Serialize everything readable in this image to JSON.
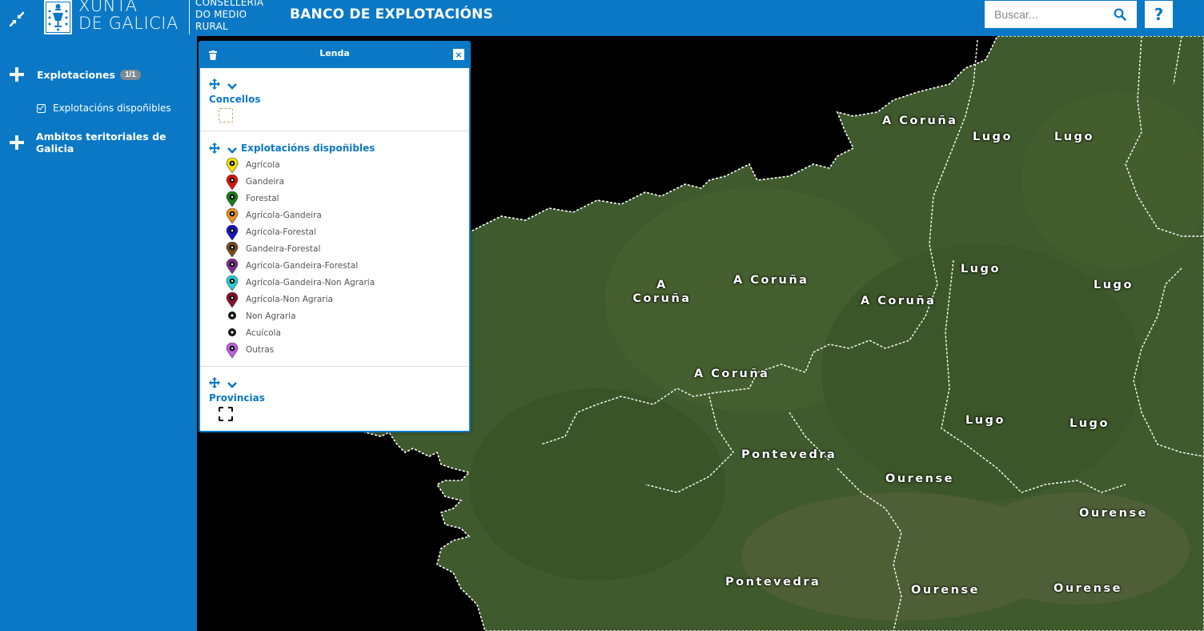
{
  "header": {
    "logo_line1": "XUNTA",
    "logo_line2": "DE GALICIA",
    "consel_line1": "CONSELLERÍA",
    "consel_line2": "DO MEDIO",
    "consel_line3": "RURAL",
    "title": "BANCO DE EXPLOTACIÓNS",
    "search_placeholder": "Buscar...",
    "help_label": "?"
  },
  "sidebar": {
    "groups": [
      {
        "label": "Explotaciones",
        "badge": "1/1"
      },
      {
        "label": "Ambitos teritoriales de Galicia"
      }
    ],
    "sublayer": "Explotacións dispoñibles"
  },
  "legend": {
    "title": "Lenda",
    "close_label": "×",
    "sections": [
      {
        "title": "Concellos",
        "swatch_color": "#c8a063"
      },
      {
        "title": "Explotacións dispoñibles"
      },
      {
        "title": "Provincias",
        "swatch_color": "#000000"
      }
    ],
    "items": [
      {
        "label": "Agrícola",
        "color": "#f5e400"
      },
      {
        "label": "Gandeira",
        "color": "#e3120b"
      },
      {
        "label": "Forestal",
        "color": "#1a7d1a"
      },
      {
        "label": "Agrícola-Gandeira",
        "color": "#f09020"
      },
      {
        "label": "Agrícola-Forestal",
        "color": "#1414c8"
      },
      {
        "label": "Gandeira-Forestal",
        "color": "#7a4a1e"
      },
      {
        "label": "Agrícola-Gandeira-Forestal",
        "color": "#7a2f8f"
      },
      {
        "label": "Agrícola-Gandeira-Non Agraria",
        "color": "#20d0d8"
      },
      {
        "label": "Agrícola-Non Agraria",
        "color": "#8a1030"
      },
      {
        "label": "Non Agraria",
        "color": "#111111"
      },
      {
        "label": "Acuícola",
        "color": "#111111"
      },
      {
        "label": "Outras",
        "color": "#c060e0"
      }
    ]
  },
  "map": {
    "labels": [
      "A Coruña",
      "Lugo",
      "Lugo",
      "A Coruña",
      "A Coruña",
      "A Coruña",
      "Lugo",
      "Lugo",
      "A Coruña",
      "Lugo",
      "Lugo",
      "Pontevedra",
      "Ourense",
      "Ourense",
      "Pontevedra",
      "Ourense",
      "Ourense"
    ],
    "land_color": "#3f5a2c"
  }
}
